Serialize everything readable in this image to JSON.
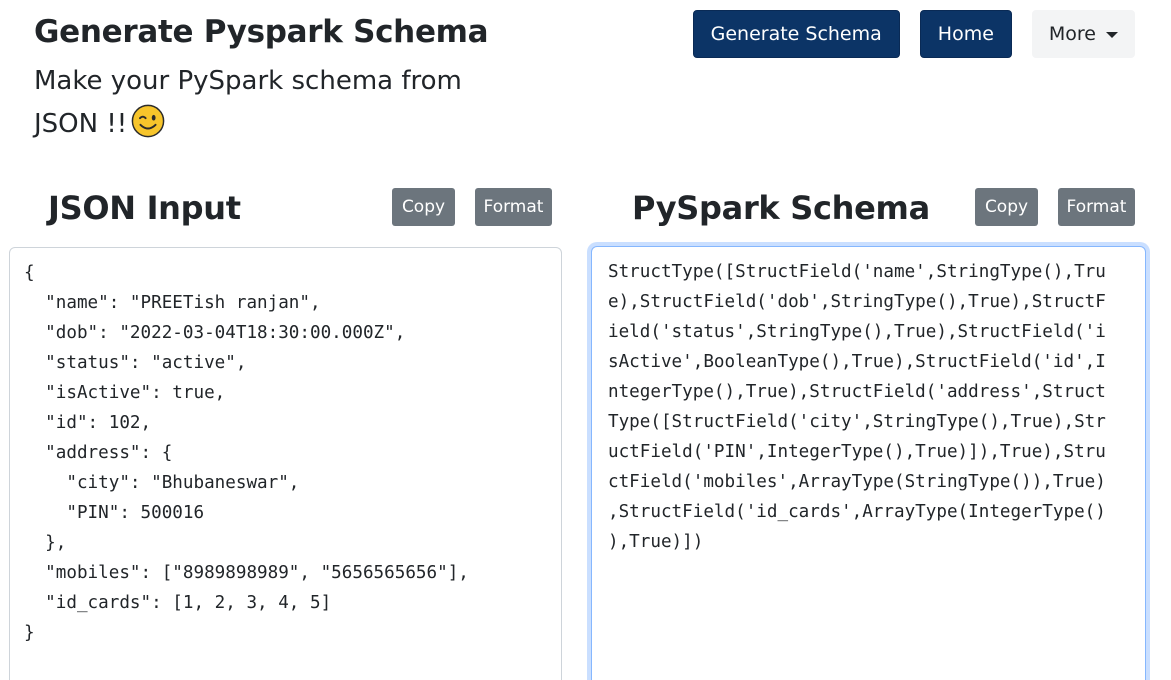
{
  "header": {
    "title": "Generate Pyspark Schema",
    "subtitle": "Make your PySpark schema from JSON !!",
    "emoji": "winking-face-emoji"
  },
  "nav": {
    "generate_label": "Generate Schema",
    "home_label": "Home",
    "more_label": "More"
  },
  "json_panel": {
    "title": "JSON Input",
    "copy_label": "Copy",
    "format_label": "Format",
    "content": "{\n  \"name\": \"PREETish ranjan\",\n  \"dob\": \"2022-03-04T18:30:00.000Z\",\n  \"status\": \"active\",\n  \"isActive\": true,\n  \"id\": 102,\n  \"address\": {\n    \"city\": \"Bhubaneswar\",\n    \"PIN\": 500016\n  },\n  \"mobiles\": [\"8989898989\", \"5656565656\"],\n  \"id_cards\": [1, 2, 3, 4, 5]\n}"
  },
  "schema_panel": {
    "title": "PySpark Schema",
    "copy_label": "Copy",
    "format_label": "Format",
    "content": "StructType([StructField('name',StringType(),Tru\ne),StructField('dob',StringType(),True),StructF\nield('status',StringType(),True),StructField('i\nsActive',BooleanType(),True),StructField('id',I\nntegerType(),True),StructField('address',Struct\nType([StructField('city',StringType(),True),Str\nuctField('PIN',IntegerType(),True)]),True),Stru\nctField('mobiles',ArrayType(StringType()),True)\n,StructField('id_cards',ArrayType(IntegerType()\n),True)])"
  },
  "colors": {
    "navy": "#0c3466",
    "gray_button": "#6c757d",
    "focus_border": "#86b7fe"
  }
}
